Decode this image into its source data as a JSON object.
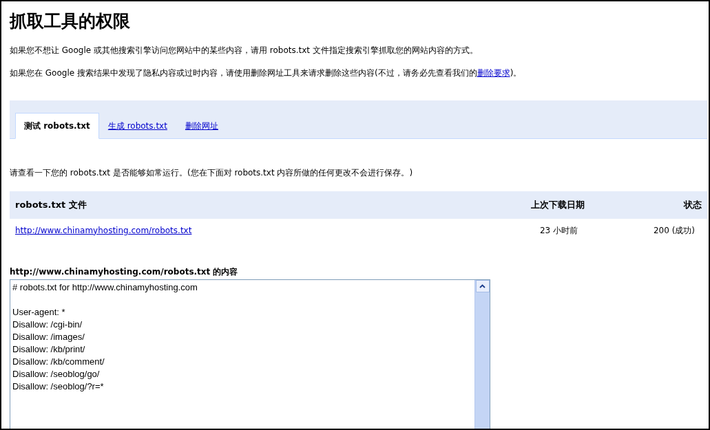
{
  "title": "抓取工具的权限",
  "intro": "如果您不想让 Google 或其他搜索引擎访问您网站中的某些内容，请用 robots.txt 文件指定搜索引擎抓取您的网站内容的方式。",
  "removal_note": {
    "before": "如果您在 Google 搜索结果中发现了隐私内容或过时内容，请使用删除网址工具来请求删除这些内容(不过，请务必先查看我们的",
    "link": "删除要求",
    "after": ")。"
  },
  "tabs": [
    {
      "label": "测试 robots.txt",
      "selected": true
    },
    {
      "label": "生成 robots.txt",
      "selected": false
    },
    {
      "label": "删除网址",
      "selected": false
    }
  ],
  "test_note": "请查看一下您的 robots.txt 是否能够如常运行。(您在下面对 robots.txt 内容所做的任何更改不会进行保存。)",
  "table": {
    "columns": [
      "robots.txt 文件",
      "上次下载日期",
      "状态"
    ],
    "rows": [
      {
        "url": "http://www.chinamyhosting.com/robots.txt",
        "date": "23 小时前",
        "status": "200 (成功)"
      }
    ]
  },
  "contents": {
    "label": "http://www.chinamyhosting.com/robots.txt 的内容",
    "blocks": [
      [
        "# robots.txt for http://www.chinamyhosting.com"
      ],
      [
        "User-agent: *",
        "Disallow: /cgi-bin/",
        "Disallow: /images/",
        "Disallow: /kb/print/",
        "Disallow: /kb/comment/",
        "Disallow: /seoblog/go/",
        "Disallow: /seoblog/?r=*"
      ]
    ]
  }
}
